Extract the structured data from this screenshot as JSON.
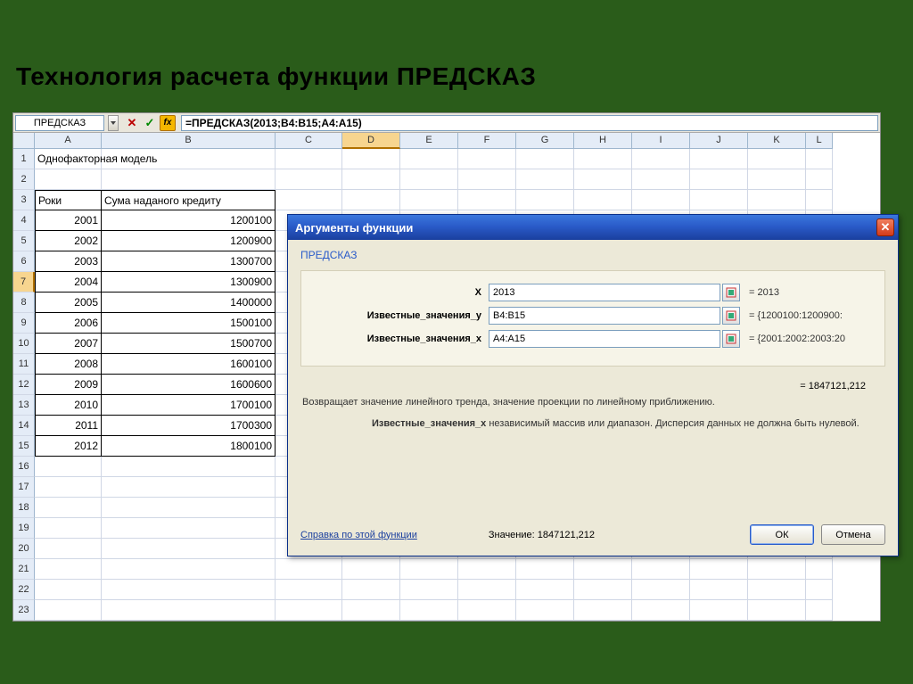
{
  "slide_title": "Технология расчета функции ПРЕДСКАЗ",
  "formula_bar": {
    "name_box": "ПРЕДСКАЗ",
    "formula": "=ПРЕДСКАЗ(2013;B4:B15;A4:A15)"
  },
  "columns": [
    "A",
    "B",
    "C",
    "D",
    "E",
    "F",
    "G",
    "H",
    "I",
    "J",
    "K",
    "L"
  ],
  "col_widths": [
    "cA",
    "cB",
    "cC",
    "cD",
    "cE",
    "cF",
    "cG",
    "cH",
    "cI",
    "cJ",
    "cK",
    "cL"
  ],
  "row_count": 23,
  "selected_row": 7,
  "selected_col": "D",
  "cells": {
    "A1": "Однофакторная модель",
    "A3": "Роки",
    "B3": "Сума наданого кредиту",
    "data": [
      {
        "row": 4,
        "A": "2001",
        "B": "1200100"
      },
      {
        "row": 5,
        "A": "2002",
        "B": "1200900"
      },
      {
        "row": 6,
        "A": "2003",
        "B": "1300700"
      },
      {
        "row": 7,
        "A": "2004",
        "B": "1300900"
      },
      {
        "row": 8,
        "A": "2005",
        "B": "1400000"
      },
      {
        "row": 9,
        "A": "2006",
        "B": "1500100"
      },
      {
        "row": 10,
        "A": "2007",
        "B": "1500700"
      },
      {
        "row": 11,
        "A": "2008",
        "B": "1600100"
      },
      {
        "row": 12,
        "A": "2009",
        "B": "1600600"
      },
      {
        "row": 13,
        "A": "2010",
        "B": "1700100"
      },
      {
        "row": 14,
        "A": "2011",
        "B": "1700300"
      },
      {
        "row": 15,
        "A": "2012",
        "B": "1800100"
      }
    ]
  },
  "dialog": {
    "title": "Аргументы функции",
    "fn_name": "ПРЕДСКАЗ",
    "args": [
      {
        "label": "X",
        "value": "2013",
        "eval": "= 2013"
      },
      {
        "label": "Известные_значения_y",
        "value": "B4:B15",
        "eval": "= {1200100:1200900:"
      },
      {
        "label": "Известные_значения_x",
        "value": "A4:A15",
        "eval": "= {2001:2002:2003:20"
      }
    ],
    "result_eq": "= 1847121,212",
    "desc1": "Возвращает значение линейного тренда, значение проекции по линейному приближению.",
    "desc2_bold": "Известные_значения_x",
    "desc2_rest": " независимый массив или диапазон. Дисперсия данных не должна быть нулевой.",
    "help_link": "Справка по этой функции",
    "value_label": "Значение: 1847121,212",
    "ok": "ОК",
    "cancel": "Отмена"
  }
}
